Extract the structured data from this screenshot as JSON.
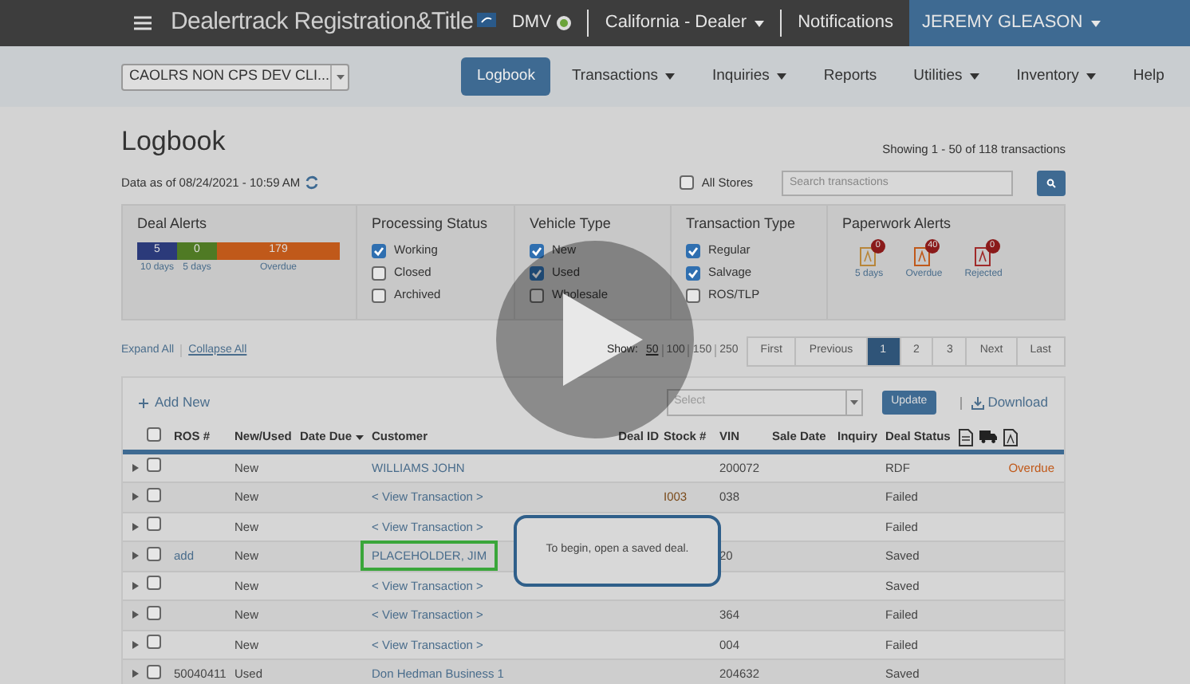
{
  "header": {
    "brand": "Dealertrack Registration&Title",
    "dmv": {
      "label": "DMV",
      "connected": true
    },
    "dealer": "California - Dealer",
    "notifications": "Notifications",
    "user": "JEREMY GLEASON"
  },
  "nav": {
    "dealer_select": "CAOLRS NON CPS DEV CLI...",
    "items": [
      {
        "label": "Logbook",
        "selected": true,
        "menu": false
      },
      {
        "label": "Transactions",
        "selected": false,
        "menu": true
      },
      {
        "label": "Inquiries",
        "selected": false,
        "menu": true
      },
      {
        "label": "Reports",
        "selected": false,
        "menu": false
      },
      {
        "label": "Utilities",
        "selected": false,
        "menu": true
      },
      {
        "label": "Inventory",
        "selected": false,
        "menu": true
      },
      {
        "label": "Help",
        "selected": false,
        "menu": false
      }
    ]
  },
  "page": {
    "title": "Logbook",
    "data_as_of": "Data as of 08/24/2021 - 10:59 AM",
    "showing": "Showing 1 - 50 of 118 transactions",
    "all_stores": {
      "label": "All Stores",
      "checked": false
    },
    "search_placeholder": "Search transactions"
  },
  "filters": {
    "deal_alerts": {
      "title": "Deal Alerts",
      "segments": [
        {
          "count": "5",
          "label": "10 days",
          "color": "#2b3a7a"
        },
        {
          "count": "0",
          "label": "5 days",
          "color": "#4f7a24"
        },
        {
          "count": "179",
          "label": "Overdue",
          "color": "#c0591a"
        }
      ]
    },
    "groups": [
      {
        "title": "Processing Status",
        "options": [
          {
            "label": "Working",
            "checked": true
          },
          {
            "label": "Closed",
            "checked": false
          },
          {
            "label": "Archived",
            "checked": false
          }
        ]
      },
      {
        "title": "Vehicle Type",
        "options": [
          {
            "label": "New",
            "checked": true
          },
          {
            "label": "Used",
            "checked": true
          },
          {
            "label": "Wholesale",
            "checked": false
          }
        ]
      },
      {
        "title": "Transaction Type",
        "options": [
          {
            "label": "Regular",
            "checked": true
          },
          {
            "label": "Salvage",
            "checked": true
          },
          {
            "label": "ROS/TLP",
            "checked": false
          }
        ]
      }
    ],
    "paperwork_alerts": {
      "title": "Paperwork Alerts",
      "items": [
        {
          "count": "0",
          "label": "5 days",
          "color": "#b8863a"
        },
        {
          "count": "40",
          "label": "Overdue",
          "color": "#c0591a"
        },
        {
          "count": "0",
          "label": "Rejected",
          "color": "#a02a2a"
        }
      ]
    }
  },
  "controls": {
    "expand_all": "Expand All",
    "collapse_all": "Collapse All",
    "show_label": "Show:",
    "show_options": [
      {
        "label": "50",
        "selected": true
      },
      {
        "label": "100",
        "selected": false
      },
      {
        "label": "150",
        "selected": false
      },
      {
        "label": "250",
        "selected": false
      }
    ],
    "pages": [
      {
        "label": "First",
        "selected": false
      },
      {
        "label": "Previous",
        "selected": false
      },
      {
        "label": "1",
        "selected": true
      },
      {
        "label": "2",
        "selected": false
      },
      {
        "label": "3",
        "selected": false
      },
      {
        "label": "Next",
        "selected": false
      },
      {
        "label": "Last",
        "selected": false
      }
    ]
  },
  "table": {
    "select_all": {
      "checked": false
    },
    "add_new": "Add New",
    "select_placeholder": "Select",
    "update": "Update",
    "download": "Download",
    "columns": [
      "ROS #",
      "New/Used",
      "Date Due",
      "Customer",
      "Deal ID",
      "Stock #",
      "VIN",
      "Sale Date",
      "Inquiry",
      "Deal Status"
    ],
    "rows": [
      {
        "checked": false,
        "ros": "",
        "new_used": "New",
        "customer": "WILLIAMS JOHN",
        "highlighted": false,
        "stock": "",
        "vin": "200072",
        "status": "RDF",
        "alert": "Overdue"
      },
      {
        "ros": "",
        "new_used": "New",
        "customer": "< View Transaction >",
        "checked": false,
        "highlighted": false,
        "stock": "I003",
        "vin": "038",
        "status": "Failed",
        "alert": ""
      },
      {
        "ros": "",
        "new_used": "New",
        "customer": "< View Transaction >",
        "checked": false,
        "highlighted": false,
        "stock": "",
        "vin": "",
        "status": "Failed",
        "alert": ""
      },
      {
        "checked": false,
        "ros": "add",
        "new_used": "New",
        "customer": "PLACEHOLDER, JIM",
        "highlighted": true,
        "stock": "",
        "vin": "20",
        "status": "Saved",
        "alert": ""
      },
      {
        "ros": "",
        "new_used": "New",
        "customer": "< View Transaction >",
        "checked": false,
        "highlighted": false,
        "stock": "",
        "vin": "",
        "status": "Saved",
        "alert": ""
      },
      {
        "ros": "",
        "new_used": "New",
        "customer": "< View Transaction >",
        "checked": false,
        "highlighted": false,
        "stock": "",
        "vin": "364",
        "status": "Failed",
        "alert": ""
      },
      {
        "ros": "",
        "new_used": "New",
        "customer": "< View Transaction >",
        "checked": false,
        "highlighted": false,
        "stock": "",
        "vin": "004",
        "status": "Failed",
        "alert": ""
      },
      {
        "checked": false,
        "ros": "50040411",
        "new_used": "Used",
        "customer": "Don Hedman Business 1",
        "highlighted": false,
        "stock": "",
        "vin": "204632",
        "status": "Saved",
        "alert": ""
      }
    ]
  },
  "tooltip": "To begin, open a saved deal."
}
